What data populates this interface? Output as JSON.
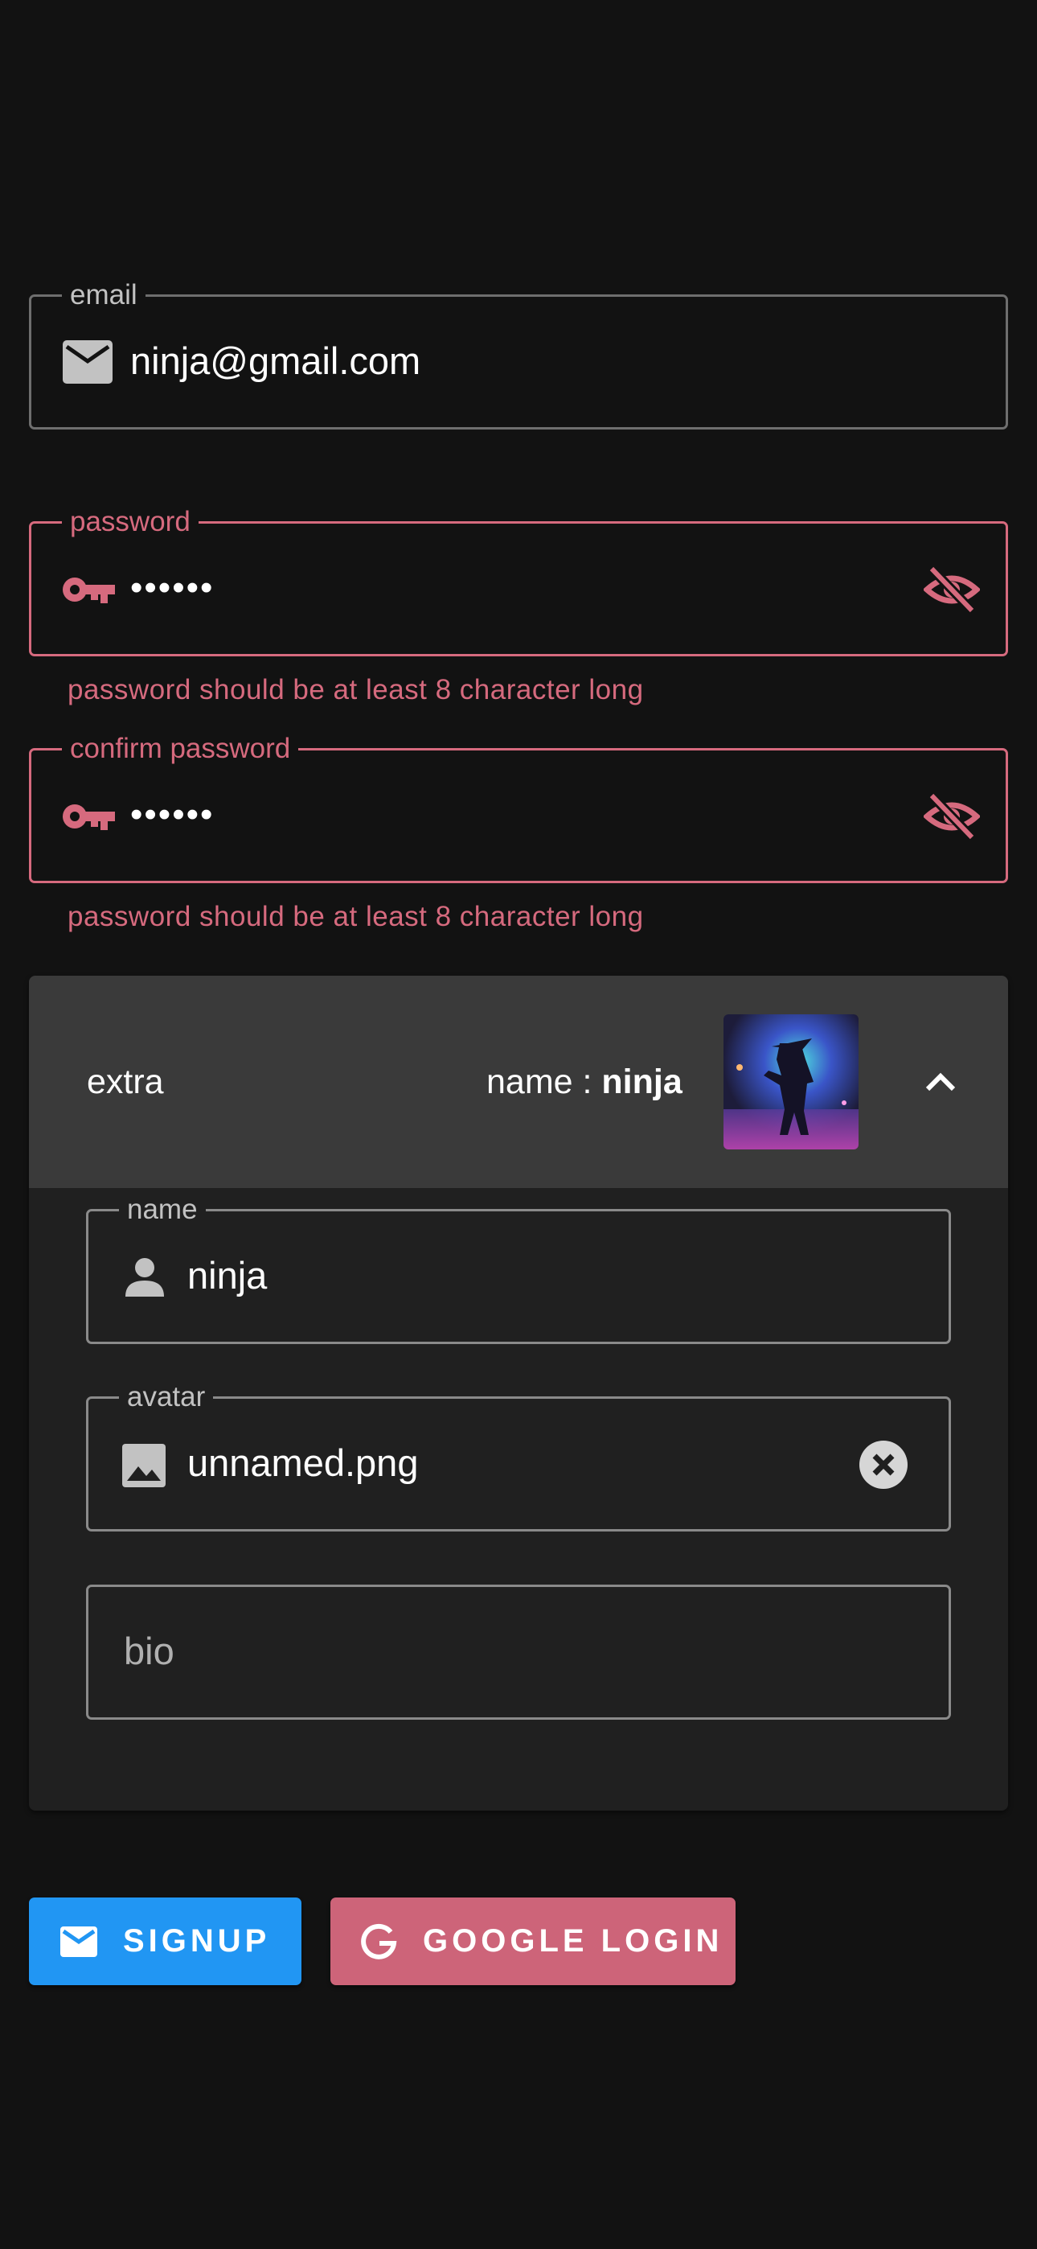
{
  "form": {
    "email": {
      "label": "email",
      "value": "ninja@gmail.com",
      "icon": "mail-icon"
    },
    "password": {
      "label": "password",
      "value": "••••••",
      "icon": "key-icon",
      "toggle_icon": "visibility-off-icon",
      "error": "password should be at least 8 character long"
    },
    "confirm_password": {
      "label": "confirm password",
      "value": "••••••",
      "icon": "key-icon",
      "toggle_icon": "visibility-off-icon",
      "error": "password should be at least 8 character long"
    }
  },
  "extra": {
    "title": "extra",
    "summary_prefix": "name : ",
    "summary_name": "ninja",
    "expand_icon": "chevron-up-icon",
    "name_field": {
      "label": "name",
      "value": "ninja",
      "icon": "person-icon"
    },
    "avatar_field": {
      "label": "avatar",
      "value": "unnamed.png",
      "icon": "image-icon",
      "clear_icon": "cancel-circle-icon"
    },
    "bio_field": {
      "placeholder": "bio"
    }
  },
  "buttons": {
    "signup": {
      "label": "SIGNUP",
      "icon": "mail-icon"
    },
    "google": {
      "label": "GOOGLE LOGIN",
      "icon": "google-g-icon"
    }
  },
  "colors": {
    "background": "#121212",
    "error": "#d66a7e",
    "primary": "#2196f3",
    "google_button": "#cd6479",
    "panel": "#202020",
    "panel_header": "#3a3a3a"
  }
}
